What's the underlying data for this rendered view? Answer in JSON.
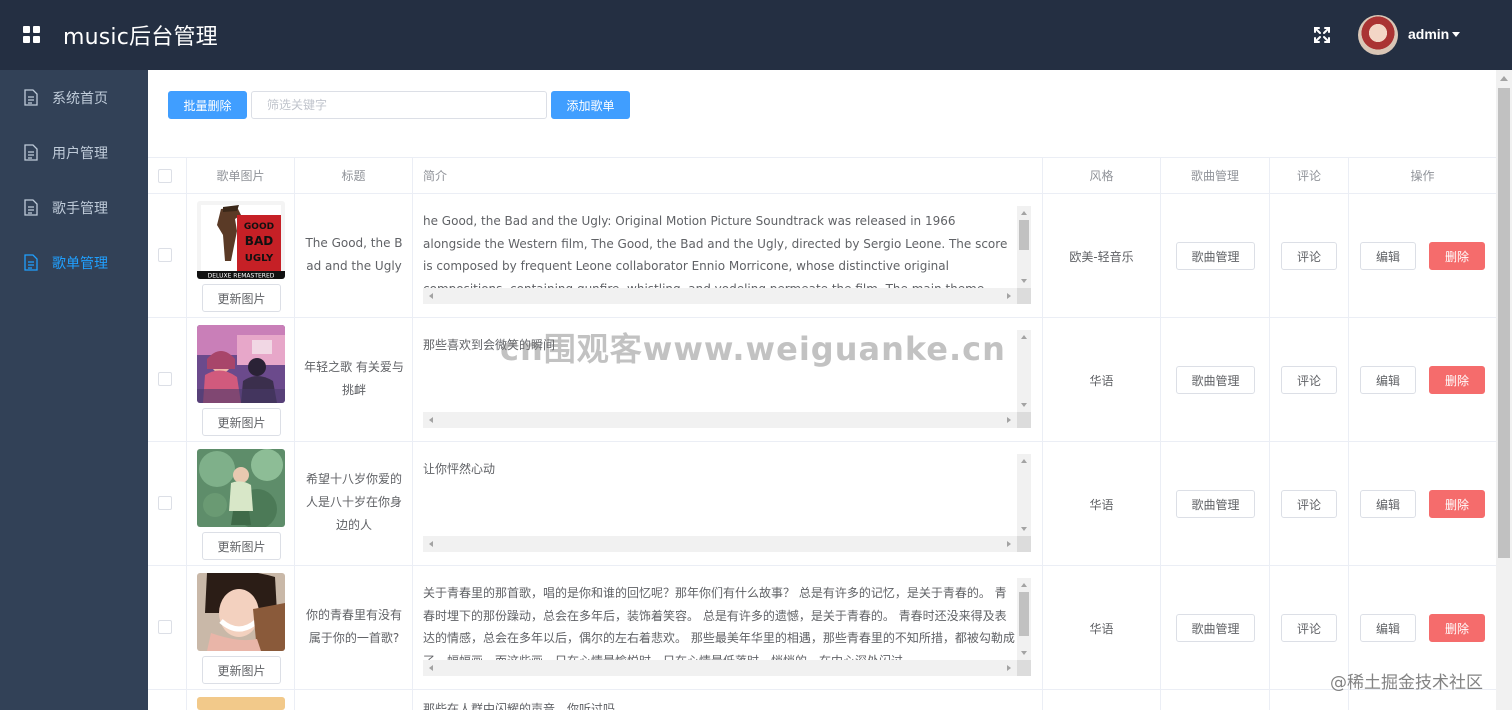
{
  "header": {
    "title": "music后台管理",
    "username": "admin"
  },
  "sidebar": {
    "items": [
      {
        "label": "系统首页"
      },
      {
        "label": "用户管理"
      },
      {
        "label": "歌手管理"
      },
      {
        "label": "歌单管理"
      }
    ]
  },
  "toolbar": {
    "batch_delete": "批量删除",
    "search_placeholder": "筛选关键字",
    "add_button": "添加歌单"
  },
  "table": {
    "headers": [
      "歌单图片",
      "标题",
      "简介",
      "风格",
      "歌曲管理",
      "评论",
      "操作"
    ],
    "update_image_label": "更新图片",
    "song_manage_label": "歌曲管理",
    "comment_label": "评论",
    "edit_label": "编辑",
    "delete_label": "删除",
    "rows": [
      {
        "title": "The Good, the Bad and the Ugly",
        "intro": "he Good, the Bad and the Ugly: Original Motion Picture Soundtrack was released in 1966 alongside the Western film, The Good, the Bad and the Ugly, directed by Sergio Leone. The score is composed by frequent Leone collaborator Ennio Morricone, whose distinctive original compositions, containing gunfire, whistling, and yodeling permeate the film. The main theme, resembling the howling of a coyote, is a two-note melody that is a frequent motif",
        "style": "欧美-轻音乐",
        "poster_text": "THE GOOD THE BAD THE UGLY",
        "poster_badge": "DELUXE REMASTERED"
      },
      {
        "title": "年轻之歌 有关爱与挑衅",
        "intro": "那些喜欢到会微笑的瞬间",
        "style": "华语"
      },
      {
        "title": "希望十八岁你爱的人是八十岁在你身边的人",
        "intro": "让你怦然心动",
        "style": "华语"
      },
      {
        "title": "你的青春里有没有属于你的一首歌?",
        "intro": "关于青春里的那首歌，唱的是你和谁的回忆呢？那年你们有什么故事？ 总是有许多的记忆，是关于青春的。 青春时埋下的那份躁动，总会在多年后，装饰着笑容。 总是有许多的遗憾，是关于青春的。 青春时还没来得及表达的情感，总会在多年以后，偶尔的左右着悲欢。 那些最美年华里的相遇，那些青春里的不知所措，都被勾勒成了一幅幅画，而这些画，只在心情最愉悦时，只在心情最低落时，悄悄的，在内心深处闪过",
        "style": "华语"
      },
      {
        "title": "",
        "intro": "那些在人群中闪耀的声音，你听过吗",
        "style": ""
      }
    ]
  },
  "watermark": "cn围观客www.weiguanke.cn",
  "source_tag": "@稀土掘金技术社区",
  "colors": {
    "header_bg": "#242f42",
    "sidebar_bg": "#324157",
    "active": "#20a0ff",
    "primary": "#409eff",
    "danger": "#f56c6c"
  }
}
